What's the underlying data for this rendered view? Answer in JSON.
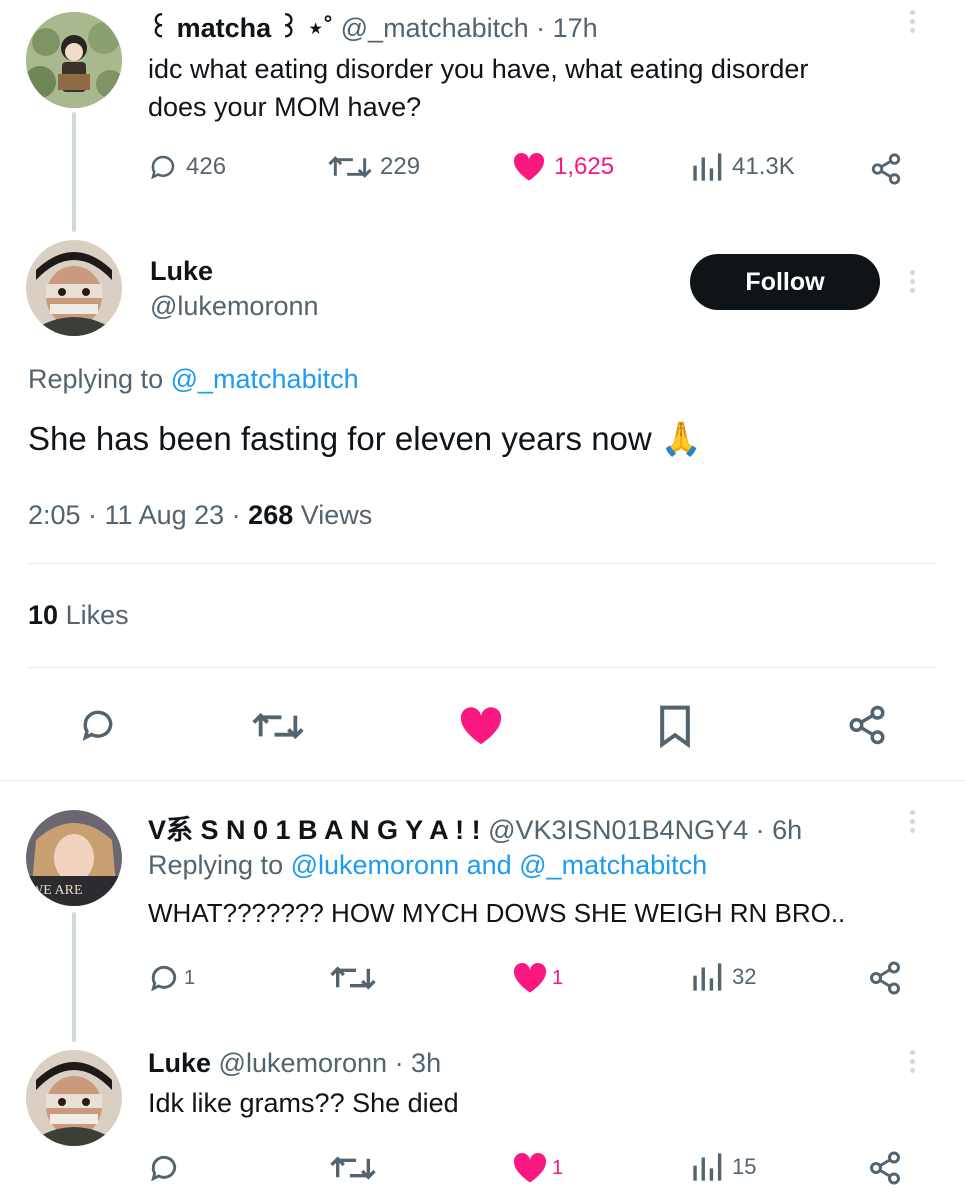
{
  "tweet1": {
    "display_name": "꒰ matcha ꒱ ⋆˚",
    "handle": "@_matchabitch",
    "time": "· 17h",
    "text_line1": "idc what eating disorder you have, what eating disorder",
    "text_line2": "does your MOM have?",
    "replies": "426",
    "retweets": "229",
    "likes": "1,625",
    "views": "41.3K"
  },
  "main_tweet": {
    "display_name": "Luke",
    "handle": "@lukemoronn",
    "follow_label": "Follow",
    "replying_prefix": "Replying to",
    "replying_handle": "@_matchabitch",
    "text": "She has been fasting for eleven years now",
    "emoji": "🙏",
    "timestamp": "2:05 · 11 Aug 23 ·",
    "views_count": "268",
    "views_label": "Views",
    "likes_count": "10",
    "likes_label": "Likes"
  },
  "reply1": {
    "display_name": "V系 S N 0 1 B A N G Y A ! !",
    "handle": "@VK3ISN01B4NGY4",
    "time": "· 6h",
    "replying_prefix": "Replying to",
    "replying_handles": "@lukemoronn and @_matchabitch",
    "text": "WHAT??????? HOW MYCH DOWS SHE WEIGH RN BRO..",
    "replies": "1",
    "likes": "1",
    "views": "32"
  },
  "reply2": {
    "display_name": "Luke",
    "handle": "@lukemoronn",
    "time": "· 3h",
    "text": "Idk like grams?? She died",
    "likes": "1",
    "views": "15"
  },
  "colors": {
    "accent": "#1d9bf0",
    "like": "#f91880",
    "text": "#0f1419",
    "muted": "#536471"
  }
}
